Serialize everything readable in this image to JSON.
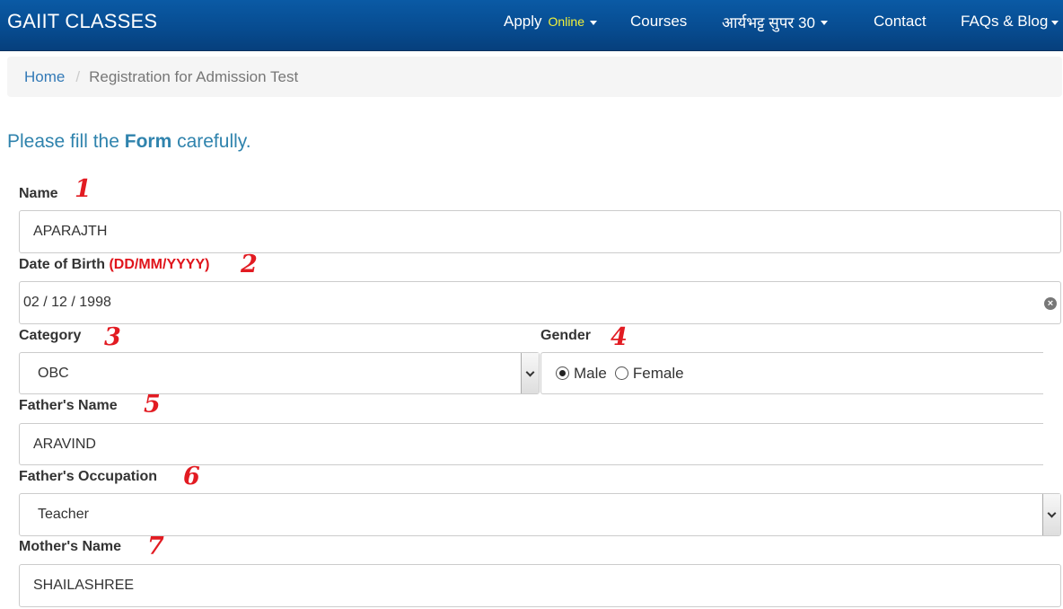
{
  "navbar": {
    "brand": "GAIIT CLASSES",
    "apply": "Apply",
    "apply_suffix": "Online",
    "courses": "Courses",
    "super30": "आर्यभट्ट सुपर 30",
    "contact": "Contact",
    "faqs": "FAQs & Blog"
  },
  "breadcrumb": {
    "home": "Home",
    "separator": "/",
    "current": "Registration for Admission Test"
  },
  "heading": {
    "pre": "Please fill the ",
    "bold": "Form",
    "post": " carefully."
  },
  "form": {
    "name": {
      "label": "Name",
      "value": "APARAJTH",
      "marker": "1"
    },
    "dob": {
      "label": "Date of Birth",
      "hint": "(DD/MM/YYYY)",
      "value": "02 / 12 / 1998",
      "marker": "2",
      "clear_icon": "clear-circle-icon"
    },
    "category": {
      "label": "Category",
      "value": "OBC",
      "marker": "3"
    },
    "gender": {
      "label": "Gender",
      "marker": "4",
      "options": [
        "Male",
        "Female"
      ],
      "selected": "Male"
    },
    "father_name": {
      "label": "Father's Name",
      "value": "ARAVIND",
      "marker": "5"
    },
    "father_occupation": {
      "label": "Father's Occupation",
      "value": "Teacher",
      "marker": "6"
    },
    "mother_name": {
      "label": "Mother's Name",
      "value": "SHAILASHREE",
      "marker": "7"
    }
  },
  "colors": {
    "navbar": "#074b8f",
    "online": "#f2f23a",
    "link": "#337ab7",
    "heading": "#2f83ad",
    "marker": "#e21b22"
  }
}
